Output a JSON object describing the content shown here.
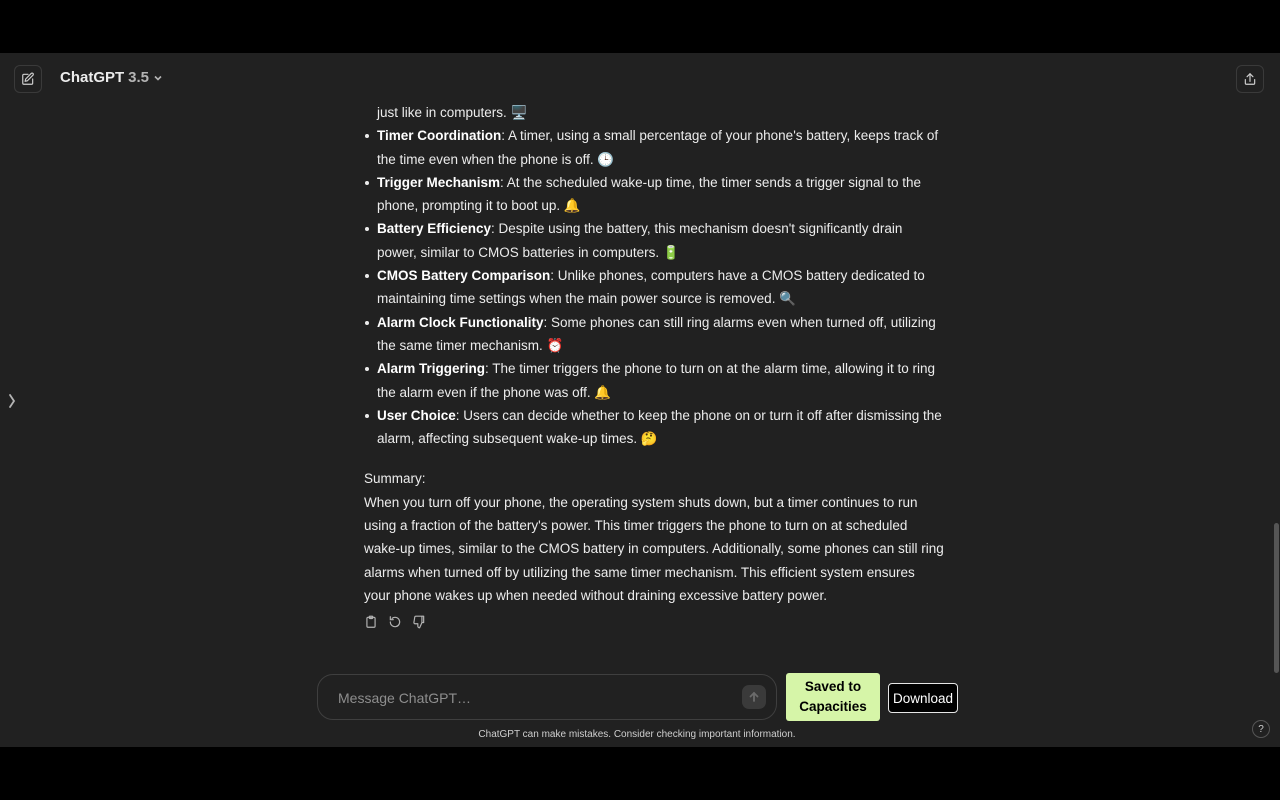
{
  "header": {
    "model_name": "ChatGPT",
    "model_version": "3.5"
  },
  "message": {
    "continuation": "just like in computers. 🖥️",
    "points": [
      {
        "title": "Timer Coordination",
        "text": ": A timer, using a small percentage of your phone's battery, keeps track of the time even when the phone is off. 🕒"
      },
      {
        "title": "Trigger Mechanism",
        "text": ": At the scheduled wake-up time, the timer sends a trigger signal to the phone, prompting it to boot up. 🔔"
      },
      {
        "title": "Battery Efficiency",
        "text": ": Despite using the battery, this mechanism doesn't significantly drain power, similar to CMOS batteries in computers. 🔋"
      },
      {
        "title": "CMOS Battery Comparison",
        "text": ": Unlike phones, computers have a CMOS battery dedicated to maintaining time settings when the main power source is removed. 🔍"
      },
      {
        "title": "Alarm Clock Functionality",
        "text": ": Some phones can still ring alarms even when turned off, utilizing the same timer mechanism. ⏰"
      },
      {
        "title": "Alarm Triggering",
        "text": ": The timer triggers the phone to turn on at the alarm time, allowing it to ring the alarm even if the phone was off. 🔔"
      },
      {
        "title": "User Choice",
        "text": ": Users can decide whether to keep the phone on or turn it off after dismissing the alarm, affecting subsequent wake-up times. 🤔"
      }
    ],
    "summary_label": "Summary:",
    "summary_text": "When you turn off your phone, the operating system shuts down, but a timer continues to run using a fraction of the battery's power. This timer triggers the phone to turn on at scheduled wake-up times, similar to the CMOS battery in computers. Additionally, some phones can still ring alarms when turned off by utilizing the same timer mechanism. This efficient system ensures your phone wakes up when needed without draining excessive battery power."
  },
  "composer": {
    "placeholder": "Message ChatGPT…"
  },
  "buttons": {
    "saved_line1": "Saved to",
    "saved_line2": "Capacities",
    "download": "Download"
  },
  "footer": {
    "disclaimer": "ChatGPT can make mistakes. Consider checking important information.",
    "help": "?"
  },
  "colors": {
    "background": "#212121",
    "saved_button": "#d6f5a8"
  }
}
